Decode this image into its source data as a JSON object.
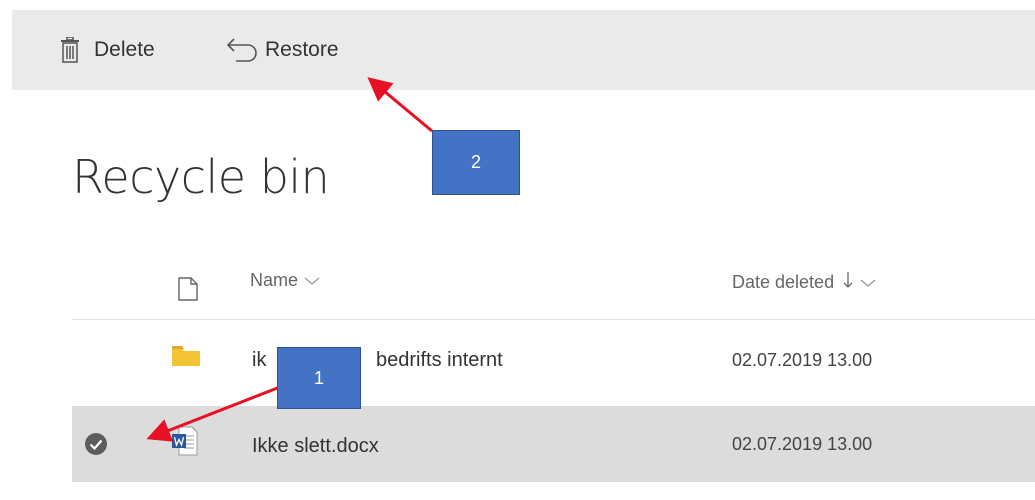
{
  "toolbar": {
    "delete_label": "Delete",
    "restore_label": "Restore"
  },
  "page": {
    "title": "Recycle bin"
  },
  "columns": {
    "name": "Name",
    "date_deleted": "Date deleted"
  },
  "rows": [
    {
      "icon": "folder-icon",
      "name_prefix": "ik",
      "name_suffix": "bedrifts internt",
      "date_deleted": "02.07.2019 13.00",
      "selected": false
    },
    {
      "icon": "word-document-icon",
      "name": "Ikke slett.docx",
      "date_deleted": "02.07.2019 13.00",
      "selected": true
    }
  ],
  "annotations": {
    "box1": "1",
    "box2": "2"
  },
  "colors": {
    "toolbar_bg": "#eaeaea",
    "selected_row_bg": "#dcdcdc",
    "annotation_box": "#4472c4",
    "annotation_arrow": "#e81123",
    "folder": "#f2c335",
    "word_blue": "#2b579a"
  }
}
